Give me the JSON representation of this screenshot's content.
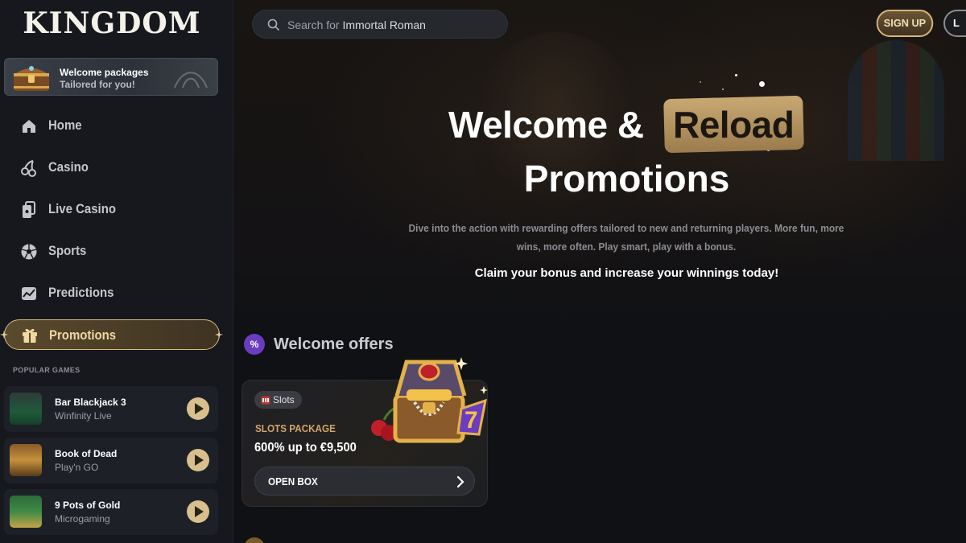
{
  "brand": {
    "logo_text": "KINGDOM"
  },
  "sidebar": {
    "welcome": {
      "title": "Welcome packages",
      "subtitle": "Tailored for you!"
    },
    "nav": [
      {
        "label": "Home",
        "icon": "home-icon"
      },
      {
        "label": "Casino",
        "icon": "cherries-icon"
      },
      {
        "label": "Live Casino",
        "icon": "cards-icon"
      },
      {
        "label": "Sports",
        "icon": "soccer-ball-icon"
      },
      {
        "label": "Predictions",
        "icon": "chart-icon"
      },
      {
        "label": "Promotions",
        "icon": "gift-icon",
        "active": true
      }
    ],
    "popular_label": "POPULAR GAMES",
    "games": [
      {
        "name": "Bar Blackjack 3",
        "provider": "Winfinity Live"
      },
      {
        "name": "Book of Dead",
        "provider": "Play'n GO"
      },
      {
        "name": "9 Pots of Gold",
        "provider": "Microgaming"
      }
    ]
  },
  "header": {
    "search": {
      "prefix": "Search for",
      "highlight": "Immortal Roman"
    },
    "signup_label": "SIGN UP",
    "login_label": "L"
  },
  "hero": {
    "title_part1": "Welcome &",
    "title_highlight": "Reload",
    "title_line2": "Promotions",
    "description": "Dive into the action with rewarding offers tailored to new and returning players. More fun, more wins, more often. Play smart, play with a bonus.",
    "claim": "Claim your bonus and increase your winnings today!"
  },
  "offers": {
    "section_icon_text": "%",
    "section_title": "Welcome offers",
    "card": {
      "tag": "Slots",
      "kicker": "SLOTS PACKAGE",
      "amount": "600% up to €9,500",
      "cta": "OPEN BOX"
    }
  },
  "colors": {
    "accent_gold": "#d8c08e",
    "sidebar_bg": "#16181d",
    "main_bg": "#0f1114",
    "offer_badge": "#6a3cc0",
    "kicker": "#d1a46a"
  }
}
